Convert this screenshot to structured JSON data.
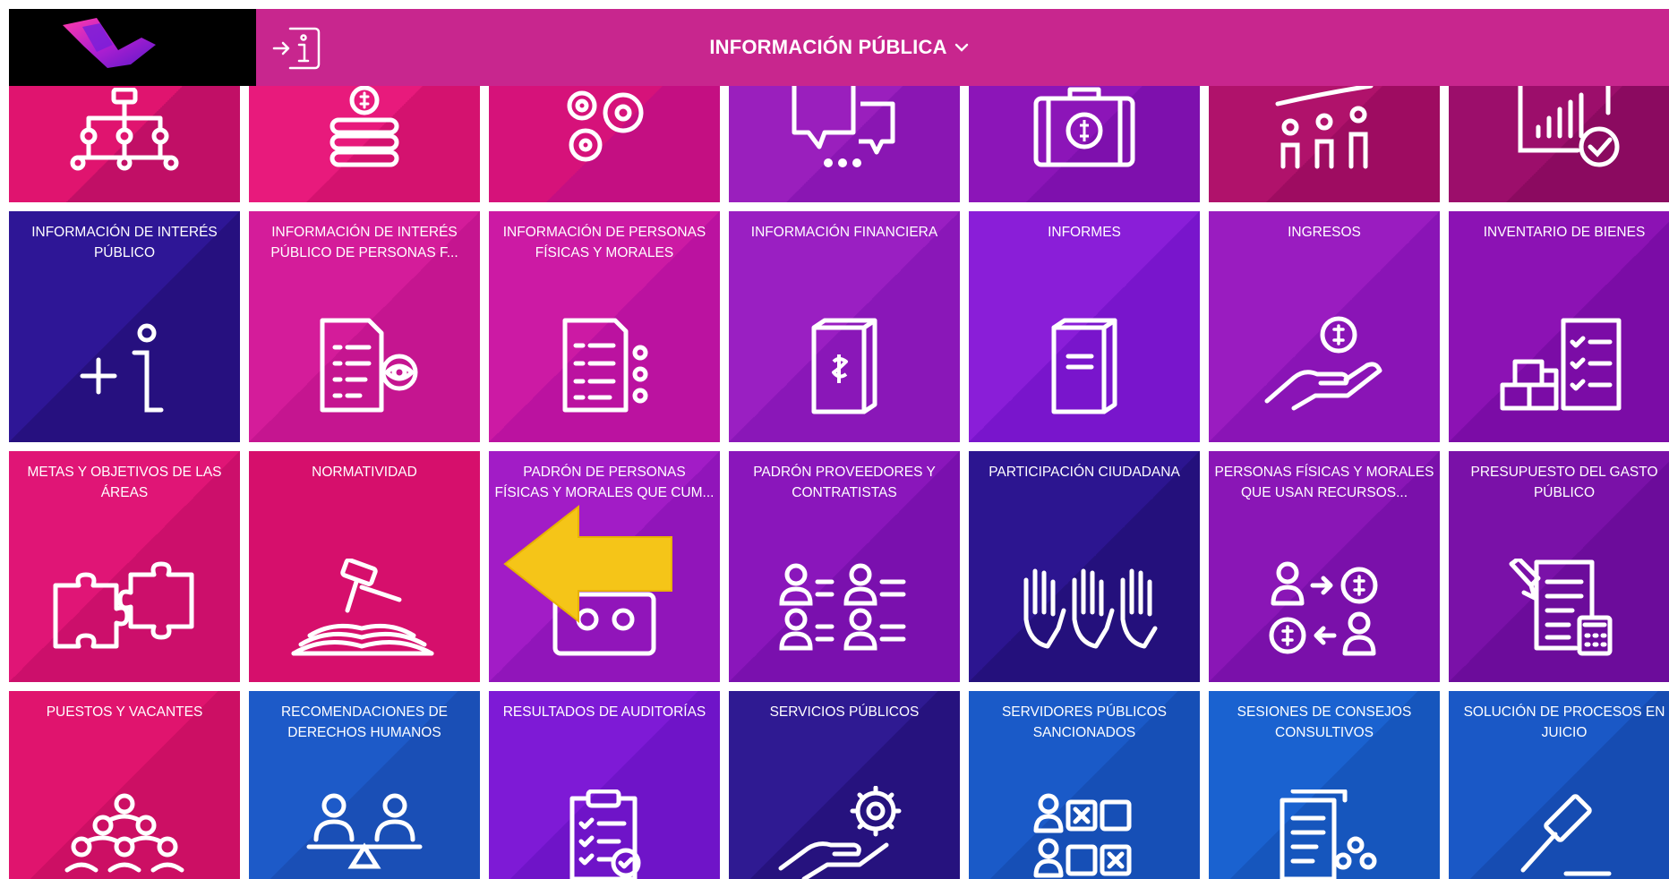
{
  "header": {
    "title": "INFORMACIÓN PÚBLICA",
    "dropdown_icon": "chevron-down-icon",
    "info_icon": "enter-info-icon",
    "colors": {
      "bar": "#c8268e",
      "logo_bg": "#000000"
    }
  },
  "tiles_row0": [
    {
      "label": "",
      "icon": "org-chart-icon"
    },
    {
      "label": "",
      "icon": "money-stack-icon"
    },
    {
      "label": "",
      "icon": "gears-icon"
    },
    {
      "label": "",
      "icon": "chat-bubbles-icon"
    },
    {
      "label": "",
      "icon": "money-case-icon"
    },
    {
      "label": "",
      "icon": "people-growth-icon"
    },
    {
      "label": "",
      "icon": "chart-check-icon"
    }
  ],
  "tiles_row1": [
    {
      "label": "INFORMACIÓN DE INTERÉS PÚBLICO",
      "icon": "plus-info-icon"
    },
    {
      "label": "INFORMACIÓN DE INTERÉS PÚBLICO DE PERSONAS F...",
      "icon": "document-eye-icon"
    },
    {
      "label": "INFORMACIÓN DE PERSONAS FÍSICAS Y MORALES",
      "icon": "document-people-icon"
    },
    {
      "label": "INFORMACIÓN FINANCIERA",
      "icon": "money-book-icon"
    },
    {
      "label": "INFORMES",
      "icon": "report-book-icon"
    },
    {
      "label": "INGRESOS",
      "icon": "hand-coin-icon"
    },
    {
      "label": "INVENTARIO DE BIENES",
      "icon": "boxes-checklist-icon"
    }
  ],
  "tiles_row2": [
    {
      "label": "METAS Y OBJETIVOS DE LAS ÁREAS",
      "icon": "puzzle-icon"
    },
    {
      "label": "NORMATIVIDAD",
      "icon": "gavel-book-icon",
      "selected": true
    },
    {
      "label": "PADRÓN DE PERSONAS FÍSICAS Y MORALES QUE CUM...",
      "icon": "registry-icon"
    },
    {
      "label": "PADRÓN PROVEEDORES Y CONTRATISTAS",
      "icon": "people-list-icon"
    },
    {
      "label": "PARTICIPACIÓN CIUDADANA",
      "icon": "raised-hands-icon"
    },
    {
      "label": "PERSONAS FÍSICAS Y MORALES QUE USAN RECURSOS...",
      "icon": "people-exchange-icon"
    },
    {
      "label": "PRESUPUESTO DEL GASTO PÚBLICO",
      "icon": "budget-calculator-icon"
    }
  ],
  "tiles_row3": [
    {
      "label": "PUESTOS Y VACANTES",
      "icon": "team-icon"
    },
    {
      "label": "RECOMENDACIONES DE DERECHOS HUMANOS",
      "icon": "people-balance-icon"
    },
    {
      "label": "RESULTADOS DE AUDITORÍAS",
      "icon": "clipboard-check-icon"
    },
    {
      "label": "SERVICIOS PÚBLICOS",
      "icon": "hand-gear-icon"
    },
    {
      "label": "SERVIDORES PÚBLICOS SANCIONADOS",
      "icon": "people-x-icon"
    },
    {
      "label": "SESIONES DE CONSEJOS CONSULTIVOS",
      "icon": "documents-people-icon"
    },
    {
      "label": "SOLUCIÓN DE PROCESOS EN JUICIO",
      "icon": "gavel-icon"
    }
  ],
  "overlay": {
    "arrow_icon": "pointer-arrow-icon",
    "arrow_color": "#f5c518"
  }
}
